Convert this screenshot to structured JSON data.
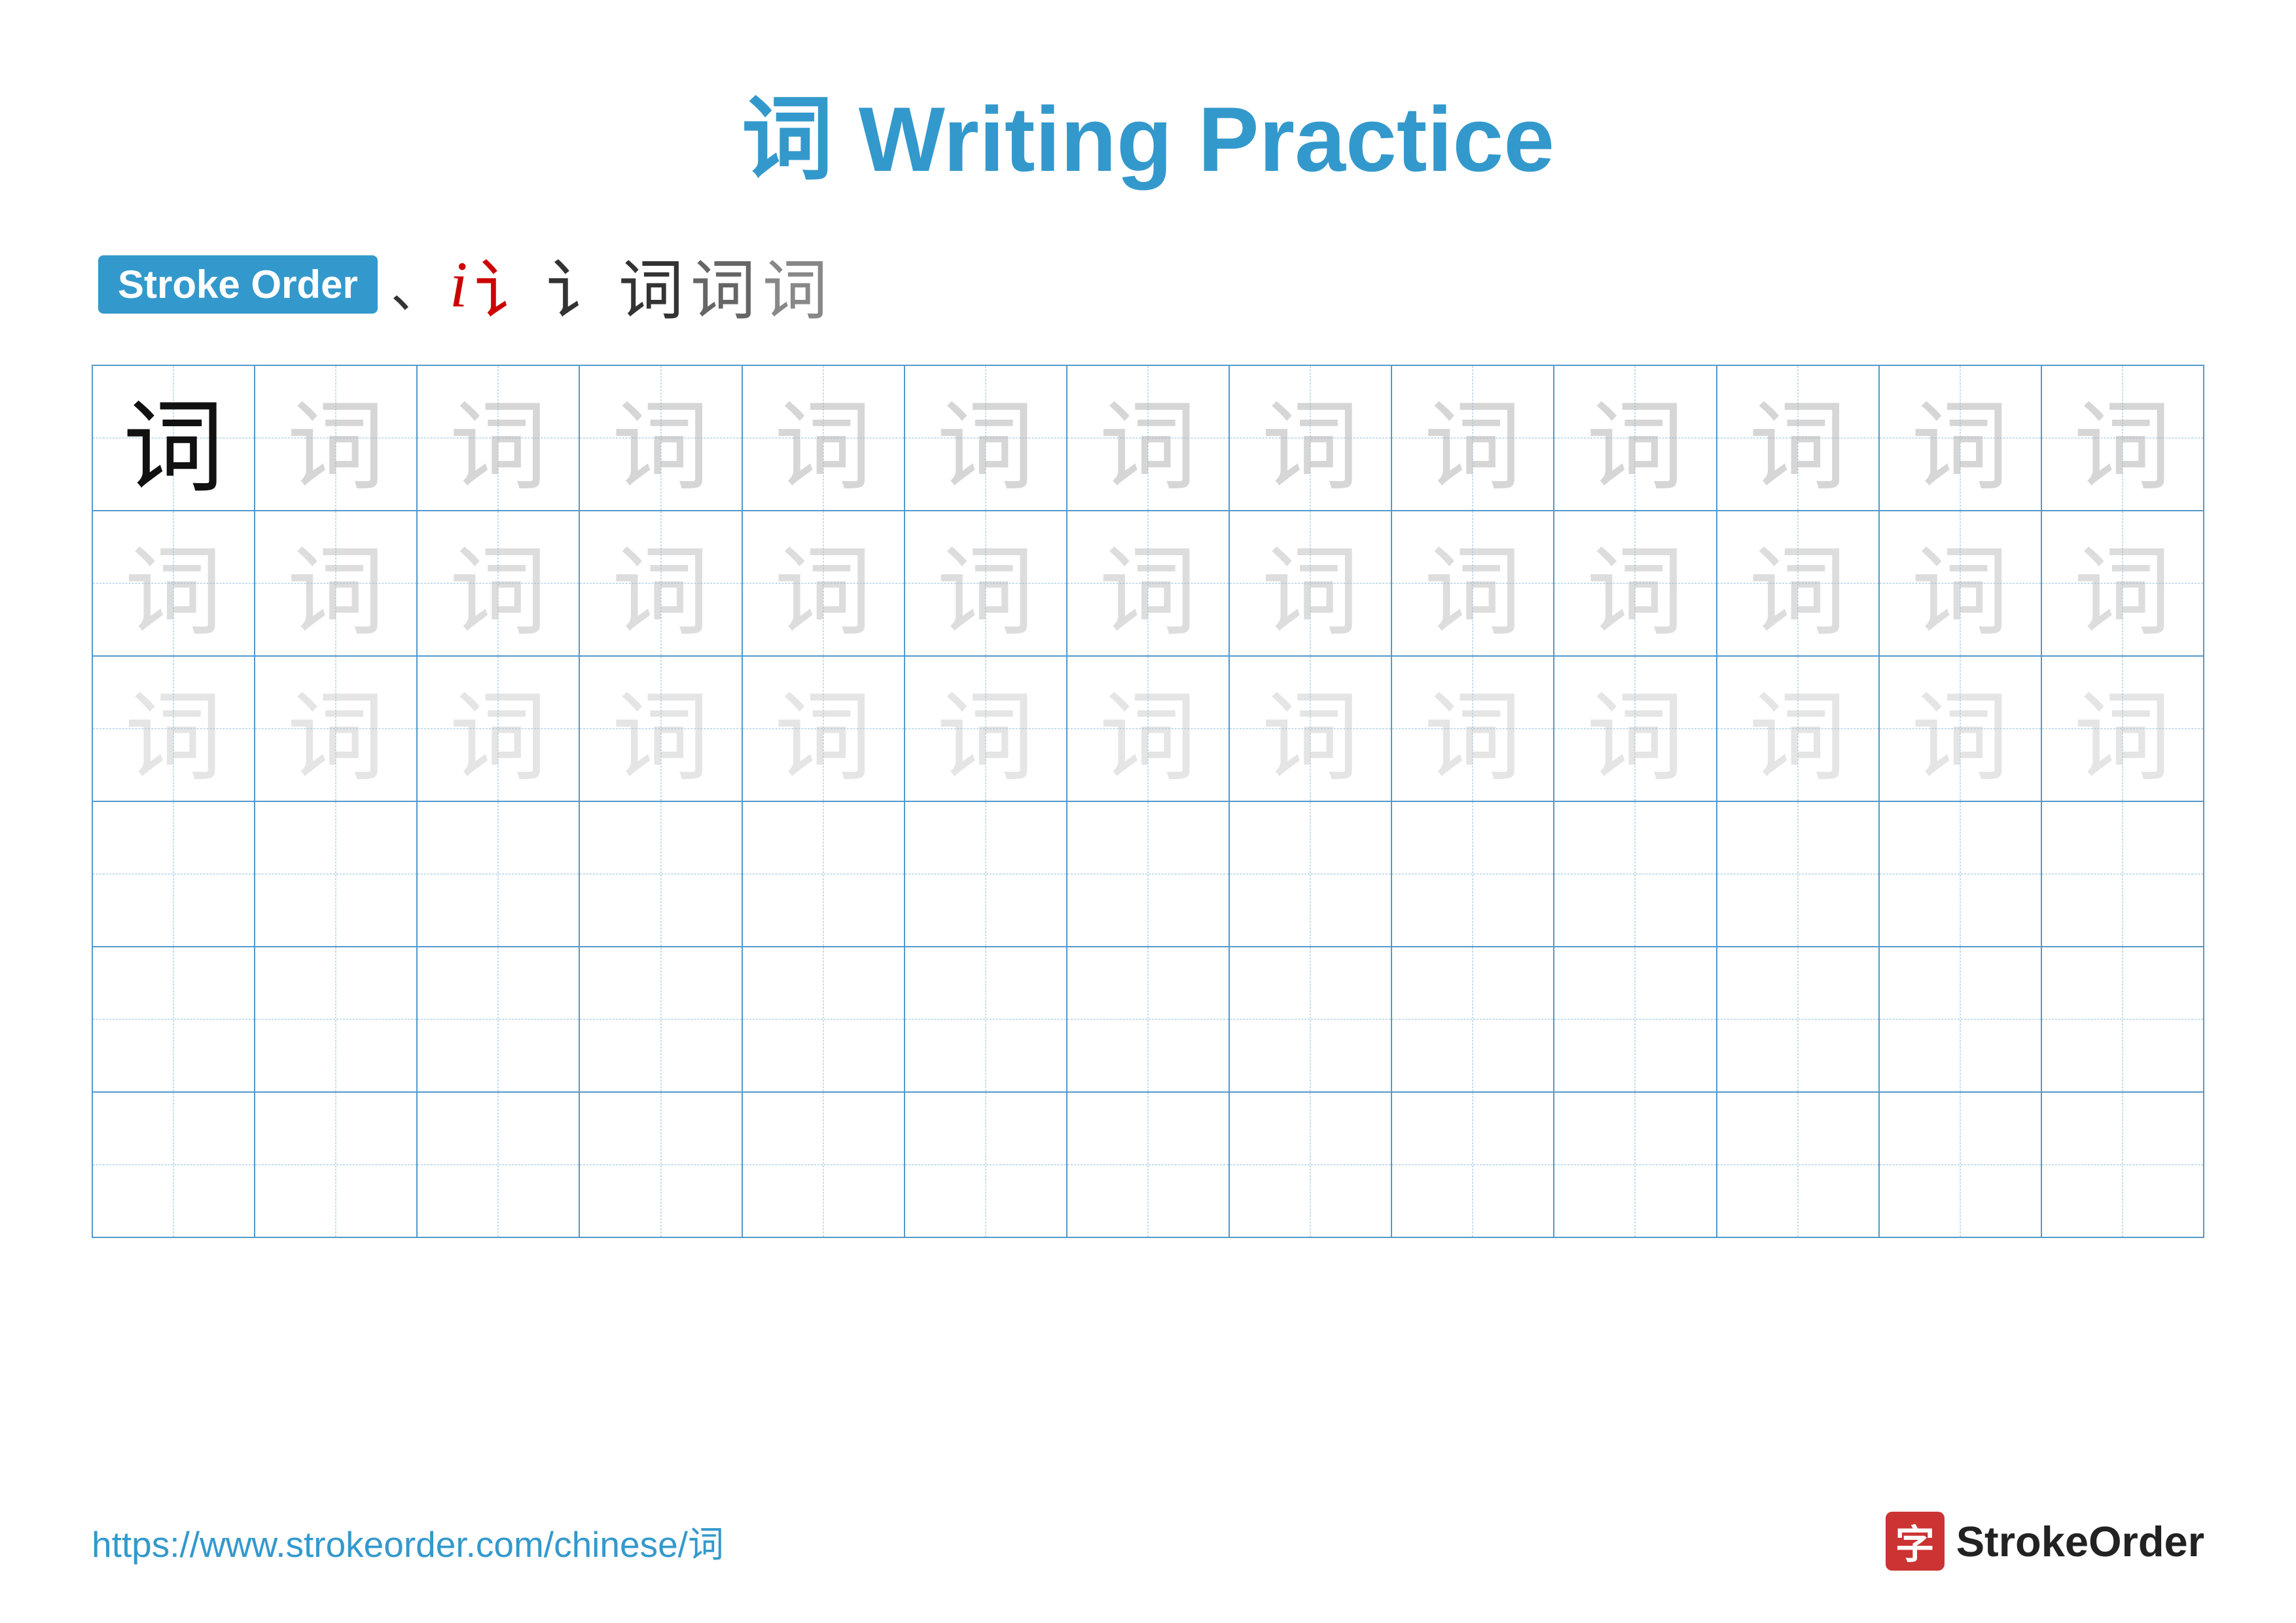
{
  "title": "词 Writing Practice",
  "stroke_order": {
    "badge_label": "Stroke Order",
    "strokes": [
      {
        "char": "丶",
        "type": "dot"
      },
      {
        "char": "i",
        "type": "red-italic"
      },
      {
        "char": "讠",
        "type": "red-outline"
      },
      {
        "char": "讠",
        "type": "dark"
      },
      {
        "char": "词",
        "type": "gray1"
      },
      {
        "char": "词",
        "type": "gray2"
      },
      {
        "char": "词",
        "type": "gray3"
      }
    ]
  },
  "character": "词",
  "grid": {
    "rows": 6,
    "cols": 13,
    "guide_rows": 3
  },
  "footer": {
    "url": "https://www.strokeorder.com/chinese/词",
    "logo_char": "字",
    "logo_text": "StrokeOrder"
  }
}
